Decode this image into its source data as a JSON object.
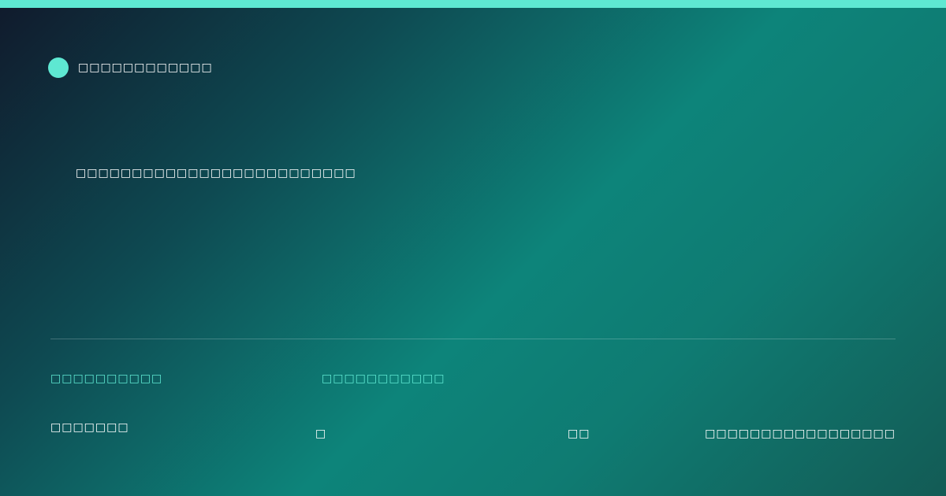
{
  "colors": {
    "accent": "#5ee8d2",
    "text": "#ffffff",
    "background_start": "#101a2c",
    "background_mid": "#0d847a",
    "background_end": "#135b55"
  },
  "brand": {
    "logo_icon": "circle-logo-icon",
    "name": "□□□□□□□□□□□□"
  },
  "headline": "□□□□□□□□□□□□□□□□□□□□□□□□□",
  "footer": {
    "label_1": "□□□□□□□□□□",
    "label_2": "□□□□□□□□□□□",
    "value_1": "□□□□□□□",
    "value_2": "□",
    "value_3": "□□",
    "value_4": "□□□□□□□□□□□□□□□□□"
  }
}
